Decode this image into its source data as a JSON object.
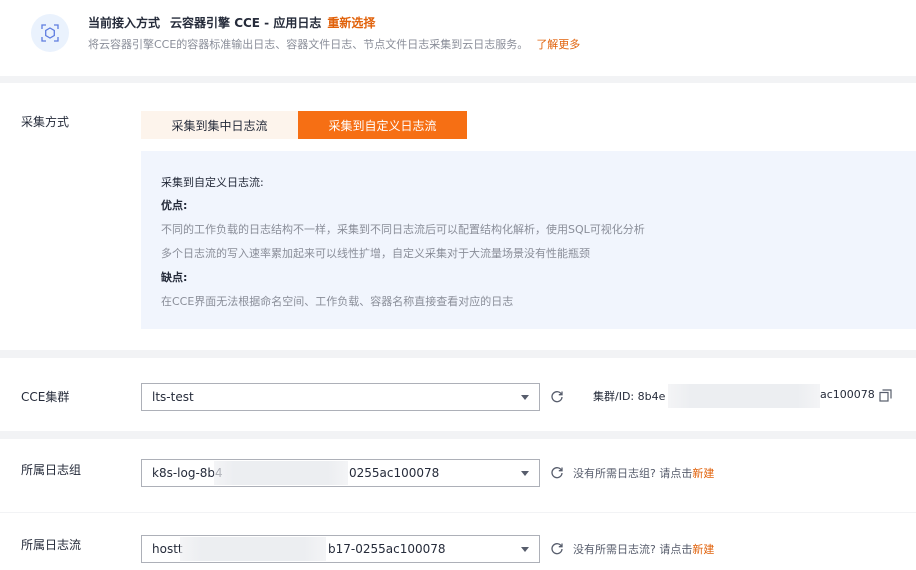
{
  "header": {
    "prefix": "当前接入方式",
    "title": "云容器引擎 CCE - 应用日志",
    "reselect": "重新选择",
    "description": "将云容器引擎CCE的容器标准输出日志、容器文件日志、节点文件日志采集到云日志服务。",
    "learn_more": "了解更多",
    "icon": "scan-target-icon",
    "colors": {
      "accent": "#e1620b",
      "primary": "#f66f14"
    }
  },
  "collect": {
    "label": "采集方式",
    "tabs": [
      {
        "label": "采集到集中日志流",
        "active": false
      },
      {
        "label": "采集到自定义日志流",
        "active": true
      }
    ],
    "info": {
      "heading": "采集到自定义日志流:",
      "pros_label": "优点:",
      "pros": [
        "不同的工作负载的日志结构不一样，采集到不同日志流后可以配置结构化解析，使用SQL可视化分析",
        "多个日志流的写入速率累加起来可以线性扩增，自定义采集对于大流量场景没有性能瓶颈"
      ],
      "cons_label": "缺点:",
      "cons": [
        "在CCE界面无法根据命名空间、工作负载、容器名称直接查看对应的日志"
      ]
    }
  },
  "cluster": {
    "label": "CCE集群",
    "value": "lts-test",
    "id_label": "集群/ID:",
    "id_prefix": "8b4e",
    "id_suffix": "ac100078"
  },
  "log_group": {
    "label": "所属日志组",
    "value_prefix": "k8s-log-8b4",
    "value_suffix": "0255ac100078",
    "hint": "没有所需日志组? 请点击",
    "create": "新建"
  },
  "log_stream": {
    "label": "所属日志流",
    "value_prefix": "hostt",
    "value_suffix": "b17-0255ac100078",
    "hint": "没有所需日志流? 请点击",
    "create": "新建"
  }
}
